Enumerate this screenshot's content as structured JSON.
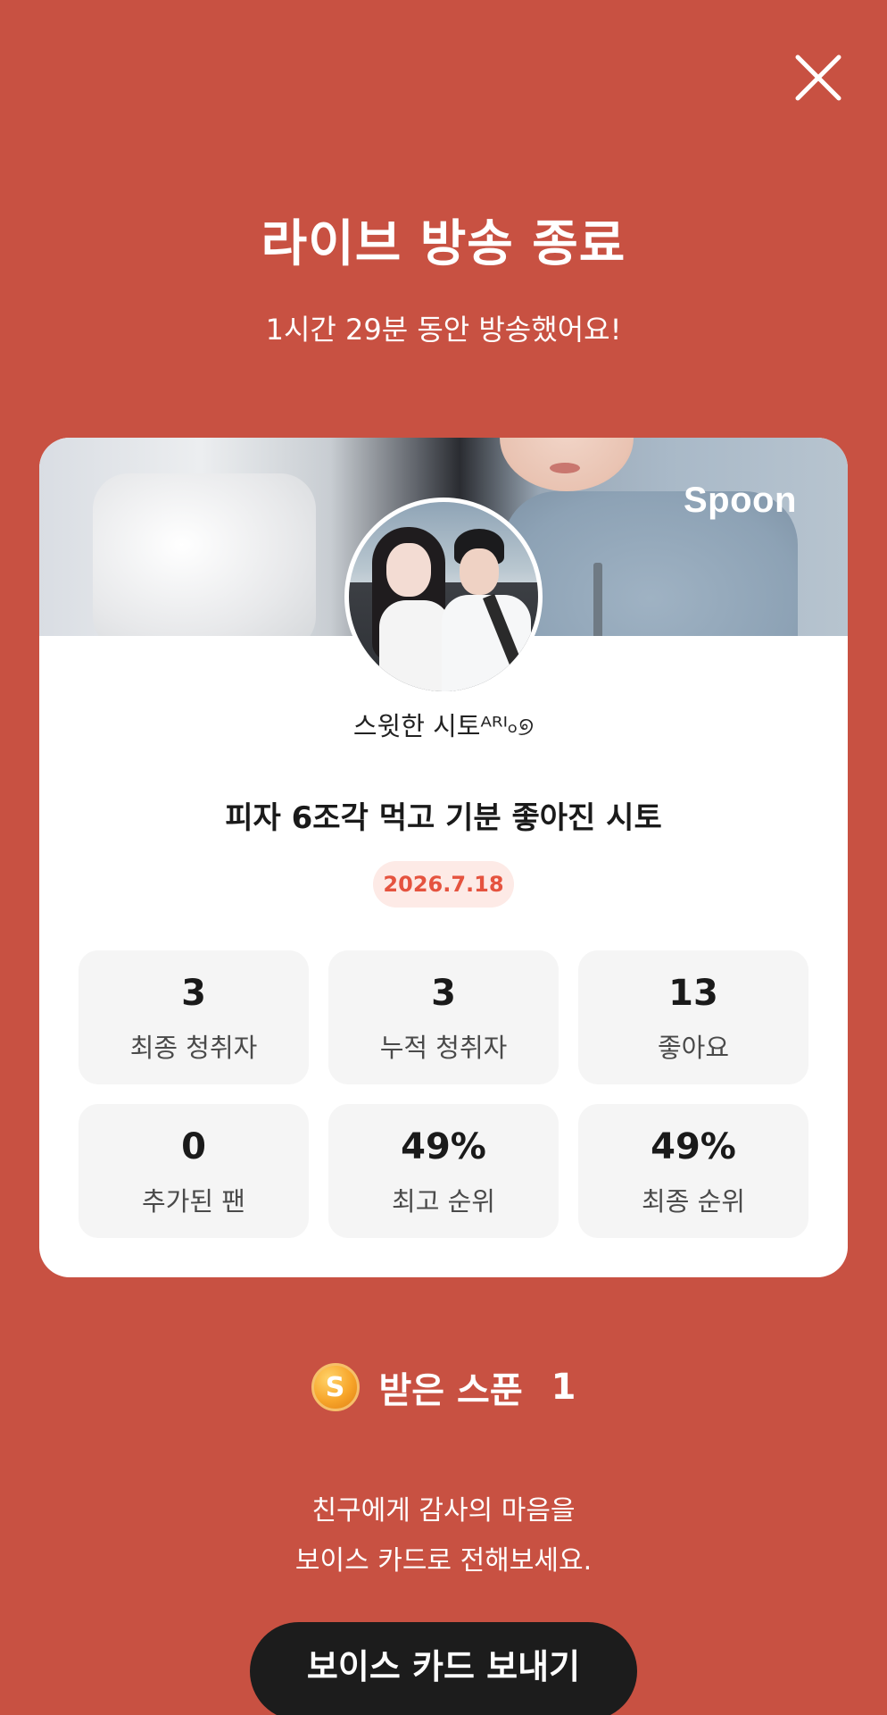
{
  "header": {
    "title": "라이브 방송 종료",
    "subtitle": "1시간 29분 동안 방송했어요!"
  },
  "card": {
    "brand": "Spoon",
    "username": "스윗한 시토ᴬᴿᴵ৹୭",
    "live_title": "피자 6조각 먹고 기분 좋아진 시토",
    "date": "2026.7.18",
    "stats": [
      {
        "value": "3",
        "label": "최종 청취자"
      },
      {
        "value": "3",
        "label": "누적 청취자"
      },
      {
        "value": "13",
        "label": "좋아요"
      },
      {
        "value": "0",
        "label": "추가된 팬"
      },
      {
        "value": "49%",
        "label": "최고 순위"
      },
      {
        "value": "49%",
        "label": "최종 순위"
      }
    ]
  },
  "spoons": {
    "coin_letter": "S",
    "label": "받은 스푼",
    "count": "1"
  },
  "thanks": {
    "line1": "친구에게 감사의 마음을",
    "line2": "보이스 카드로 전해보세요."
  },
  "voice_button": "보이스 카드 보내기",
  "colors": {
    "background": "#c85142",
    "date_badge_text": "#e5533f",
    "button": "#1c1c1c"
  }
}
